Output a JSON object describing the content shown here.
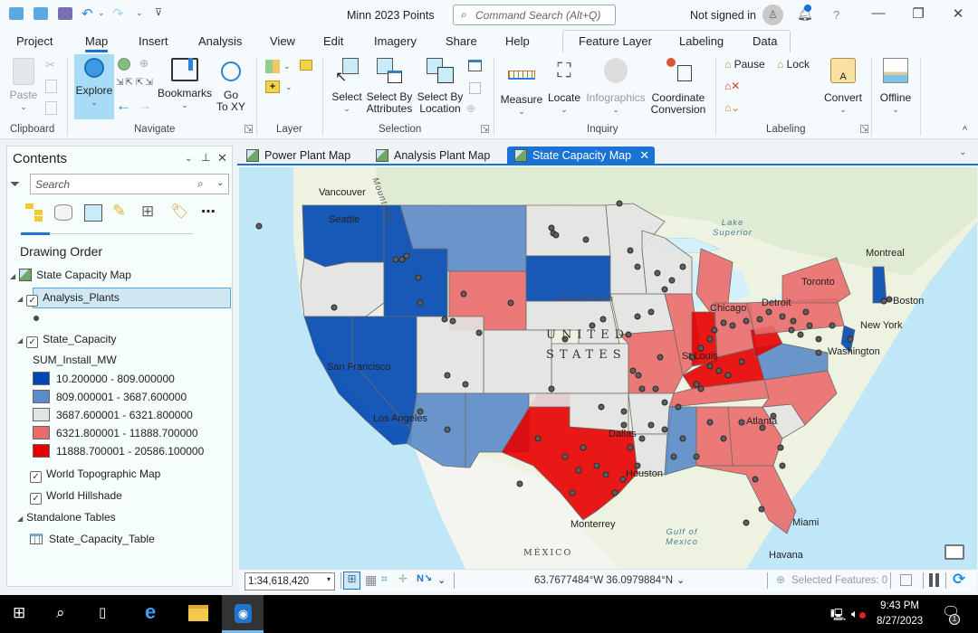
{
  "app": {
    "title": "Minn 2023 Points",
    "command_search_placeholder": "Command Search (Alt+Q)",
    "sign_in_status": "Not signed in",
    "help_label": "?",
    "quick_access": [
      "new-project-icon",
      "open-project-icon",
      "save-project-icon",
      "undo-icon",
      "redo-icon",
      "customize-toolbar-icon"
    ]
  },
  "ribbon_tabs": [
    "Project",
    "Map",
    "Insert",
    "Analysis",
    "View",
    "Edit",
    "Imagery",
    "Share",
    "Help"
  ],
  "active_ribbon_tab": "Map",
  "context_tabs": [
    "Feature Layer",
    "Labeling",
    "Data"
  ],
  "ribbon": {
    "clipboard": {
      "group": "Clipboard",
      "paste": "Paste"
    },
    "navigate": {
      "group": "Navigate",
      "explore": "Explore",
      "bookmarks": "Bookmarks",
      "goto_line1": "Go",
      "goto_line2": "To XY"
    },
    "layer": {
      "group": "Layer"
    },
    "selection": {
      "group": "Selection",
      "select": "Select",
      "sba_line1": "Select By",
      "sba_line2": "Attributes",
      "sbl_line1": "Select By",
      "sbl_line2": "Location"
    },
    "inquiry": {
      "group": "Inquiry",
      "measure": "Measure",
      "locate": "Locate",
      "infographics": "Infographics",
      "cc_line1": "Coordinate",
      "cc_line2": "Conversion"
    },
    "labeling": {
      "group": "Labeling",
      "pause": "Pause",
      "lock": "Lock",
      "convert": "Convert"
    },
    "offline": {
      "offline": "Offline"
    }
  },
  "contents": {
    "title": "Contents",
    "search_placeholder": "Search",
    "section": "Drawing Order",
    "map_name": "State Capacity Map",
    "layers": [
      {
        "name": "Analysis_Plants",
        "checked": true,
        "selected": true
      },
      {
        "name": "State_Capacity",
        "checked": true
      }
    ],
    "legend_field": "SUM_Install_MW",
    "legend": [
      {
        "label": "10.200000 - 809.000000",
        "color": "#0047b3"
      },
      {
        "label": "809.000001 - 3687.600000",
        "color": "#5b8bc9"
      },
      {
        "label": "3687.600001 - 6321.800000",
        "color": "#e3e3e3"
      },
      {
        "label": "6321.800001 - 11888.700000",
        "color": "#e96b6b"
      },
      {
        "label": "11888.700001 - 20586.100000",
        "color": "#e60000"
      }
    ],
    "basemaps": [
      "World Topographic Map",
      "World Hillshade"
    ],
    "standalone_header": "Standalone Tables",
    "tables": [
      "State_Capacity_Table"
    ]
  },
  "map_tabs": [
    {
      "label": "Power Plant Map",
      "active": false
    },
    {
      "label": "Analysis Plant Map",
      "active": false
    },
    {
      "label": "State Capacity Map",
      "active": true
    }
  ],
  "map_labels": {
    "cities": [
      "Vancouver",
      "Seattle",
      "San Francisco",
      "Los Angeles",
      "Dallas",
      "Houston",
      "Monterrey",
      "Chicago",
      "Detroit",
      "Toronto",
      "Montreal",
      "Boston",
      "New York",
      "Washington",
      "St Louis",
      "Atlanta",
      "Miami",
      "Havana"
    ],
    "regions": [
      "UNITED",
      "STATES",
      "MÉXICO",
      "Great Plains",
      "Mountains",
      "Lake Superior",
      "Gulf of Mexico"
    ]
  },
  "status_bar": {
    "scale": "1:34,618,420",
    "coordinates": "63.7677484°W 36.0979884°N",
    "selected_features": "Selected Features: 0"
  },
  "taskbar": {
    "time": "9:43 PM",
    "date": "8/27/2023",
    "notification_count": "1"
  }
}
